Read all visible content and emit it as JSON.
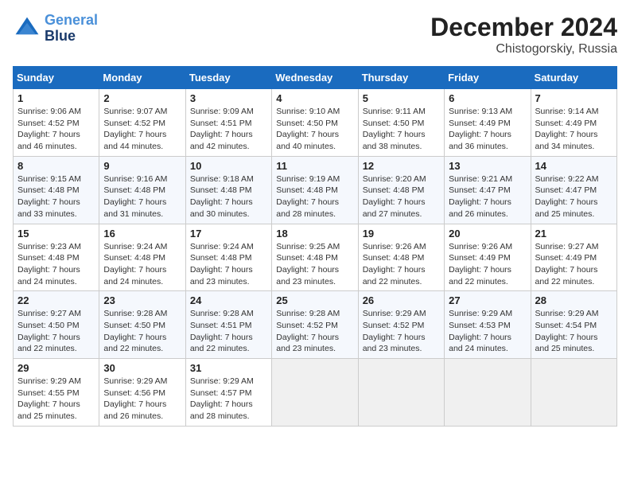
{
  "header": {
    "logo_line1": "General",
    "logo_line2": "Blue",
    "month": "December 2024",
    "location": "Chistogorskiy, Russia"
  },
  "days_of_week": [
    "Sunday",
    "Monday",
    "Tuesday",
    "Wednesday",
    "Thursday",
    "Friday",
    "Saturday"
  ],
  "weeks": [
    [
      {
        "day": "1",
        "rise": "9:06 AM",
        "set": "4:52 PM",
        "daylight": "7 hours and 46 minutes."
      },
      {
        "day": "2",
        "rise": "9:07 AM",
        "set": "4:52 PM",
        "daylight": "7 hours and 44 minutes."
      },
      {
        "day": "3",
        "rise": "9:09 AM",
        "set": "4:51 PM",
        "daylight": "7 hours and 42 minutes."
      },
      {
        "day": "4",
        "rise": "9:10 AM",
        "set": "4:50 PM",
        "daylight": "7 hours and 40 minutes."
      },
      {
        "day": "5",
        "rise": "9:11 AM",
        "set": "4:50 PM",
        "daylight": "7 hours and 38 minutes."
      },
      {
        "day": "6",
        "rise": "9:13 AM",
        "set": "4:49 PM",
        "daylight": "7 hours and 36 minutes."
      },
      {
        "day": "7",
        "rise": "9:14 AM",
        "set": "4:49 PM",
        "daylight": "7 hours and 34 minutes."
      }
    ],
    [
      {
        "day": "8",
        "rise": "9:15 AM",
        "set": "4:48 PM",
        "daylight": "7 hours and 33 minutes."
      },
      {
        "day": "9",
        "rise": "9:16 AM",
        "set": "4:48 PM",
        "daylight": "7 hours and 31 minutes."
      },
      {
        "day": "10",
        "rise": "9:18 AM",
        "set": "4:48 PM",
        "daylight": "7 hours and 30 minutes."
      },
      {
        "day": "11",
        "rise": "9:19 AM",
        "set": "4:48 PM",
        "daylight": "7 hours and 28 minutes."
      },
      {
        "day": "12",
        "rise": "9:20 AM",
        "set": "4:48 PM",
        "daylight": "7 hours and 27 minutes."
      },
      {
        "day": "13",
        "rise": "9:21 AM",
        "set": "4:47 PM",
        "daylight": "7 hours and 26 minutes."
      },
      {
        "day": "14",
        "rise": "9:22 AM",
        "set": "4:47 PM",
        "daylight": "7 hours and 25 minutes."
      }
    ],
    [
      {
        "day": "15",
        "rise": "9:23 AM",
        "set": "4:48 PM",
        "daylight": "7 hours and 24 minutes."
      },
      {
        "day": "16",
        "rise": "9:24 AM",
        "set": "4:48 PM",
        "daylight": "7 hours and 24 minutes."
      },
      {
        "day": "17",
        "rise": "9:24 AM",
        "set": "4:48 PM",
        "daylight": "7 hours and 23 minutes."
      },
      {
        "day": "18",
        "rise": "9:25 AM",
        "set": "4:48 PM",
        "daylight": "7 hours and 23 minutes."
      },
      {
        "day": "19",
        "rise": "9:26 AM",
        "set": "4:48 PM",
        "daylight": "7 hours and 22 minutes."
      },
      {
        "day": "20",
        "rise": "9:26 AM",
        "set": "4:49 PM",
        "daylight": "7 hours and 22 minutes."
      },
      {
        "day": "21",
        "rise": "9:27 AM",
        "set": "4:49 PM",
        "daylight": "7 hours and 22 minutes."
      }
    ],
    [
      {
        "day": "22",
        "rise": "9:27 AM",
        "set": "4:50 PM",
        "daylight": "7 hours and 22 minutes."
      },
      {
        "day": "23",
        "rise": "9:28 AM",
        "set": "4:50 PM",
        "daylight": "7 hours and 22 minutes."
      },
      {
        "day": "24",
        "rise": "9:28 AM",
        "set": "4:51 PM",
        "daylight": "7 hours and 22 minutes."
      },
      {
        "day": "25",
        "rise": "9:28 AM",
        "set": "4:52 PM",
        "daylight": "7 hours and 23 minutes."
      },
      {
        "day": "26",
        "rise": "9:29 AM",
        "set": "4:52 PM",
        "daylight": "7 hours and 23 minutes."
      },
      {
        "day": "27",
        "rise": "9:29 AM",
        "set": "4:53 PM",
        "daylight": "7 hours and 24 minutes."
      },
      {
        "day": "28",
        "rise": "9:29 AM",
        "set": "4:54 PM",
        "daylight": "7 hours and 25 minutes."
      }
    ],
    [
      {
        "day": "29",
        "rise": "9:29 AM",
        "set": "4:55 PM",
        "daylight": "7 hours and 25 minutes."
      },
      {
        "day": "30",
        "rise": "9:29 AM",
        "set": "4:56 PM",
        "daylight": "7 hours and 26 minutes."
      },
      {
        "day": "31",
        "rise": "9:29 AM",
        "set": "4:57 PM",
        "daylight": "7 hours and 28 minutes."
      },
      null,
      null,
      null,
      null
    ]
  ],
  "labels": {
    "sunrise": "Sunrise:",
    "sunset": "Sunset:",
    "daylight": "Daylight: 7 hours"
  }
}
